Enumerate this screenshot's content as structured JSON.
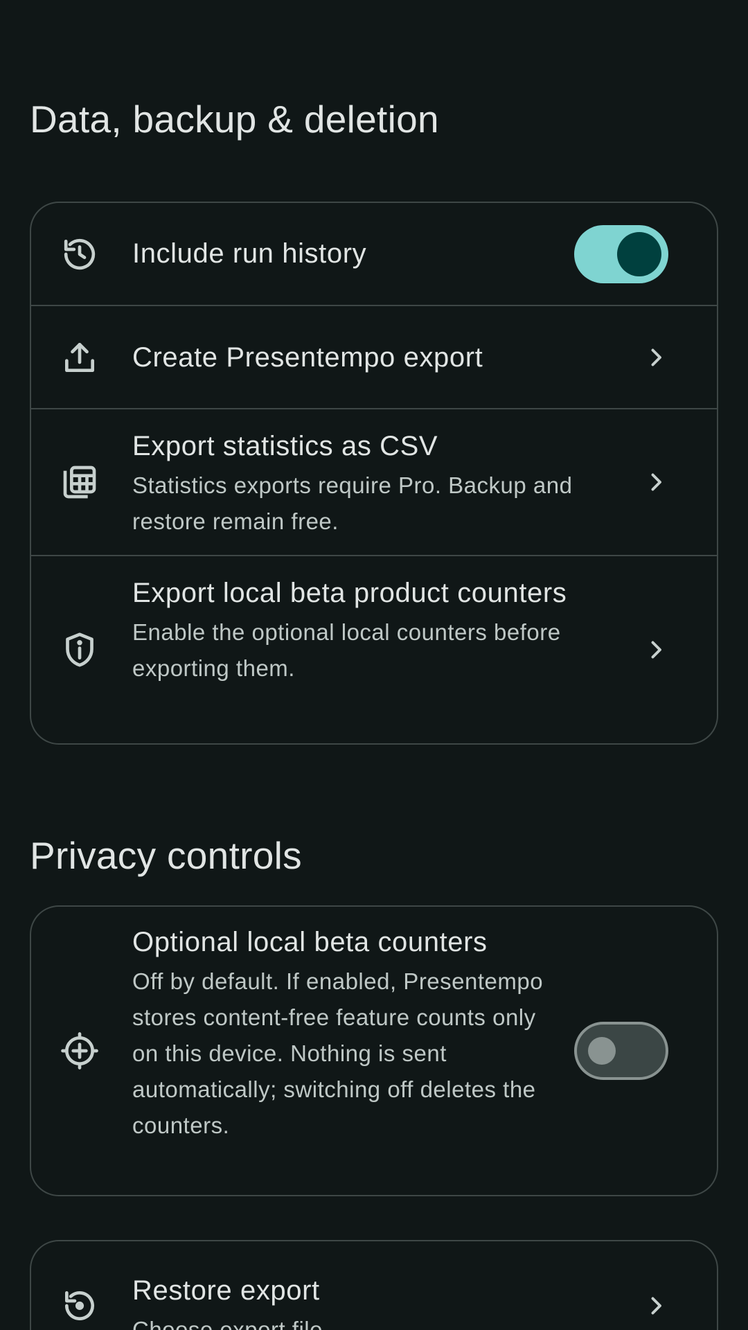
{
  "sections": [
    {
      "title": "Data, backup & deletion",
      "rows": [
        {
          "icon": "history-icon",
          "title": "Include run history",
          "toggle": true
        },
        {
          "icon": "upload-icon",
          "title": "Create Presentempo export"
        },
        {
          "icon": "spreadsheet-icon",
          "title": "Export statistics as CSV",
          "subtitle": "Statistics exports require Pro. Backup and restore remain free."
        },
        {
          "icon": "shield-info-icon",
          "title": "Export local beta product counters",
          "subtitle": "Enable the optional local counters before exporting them."
        }
      ]
    },
    {
      "title": "Privacy controls",
      "rows": [
        {
          "icon": "add-circle-icon",
          "title": "Optional local beta counters",
          "subtitle": "Off by default. If enabled, Presentempo stores content-free feature counts only on this device. Nothing is sent automatically; switching off deletes the counters.",
          "toggle": false
        }
      ]
    }
  ],
  "restore": {
    "icon": "restore-icon",
    "title": "Restore export",
    "subtitle": "Choose export file"
  },
  "colors": {
    "background": "#101717",
    "accent": "#7fd4d1",
    "border": "#3e4746"
  }
}
